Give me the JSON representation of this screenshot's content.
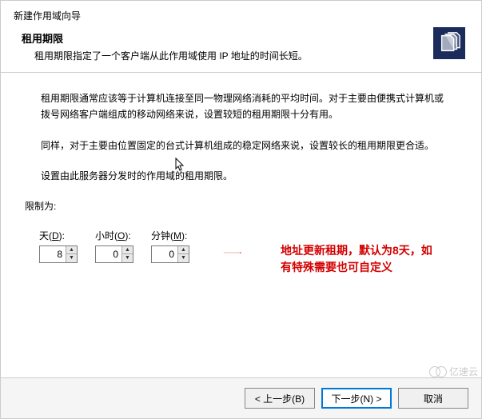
{
  "window_title": "新建作用域向导",
  "header": {
    "title": "租用期限",
    "description": "租用期限指定了一个客户端从此作用域使用 IP 地址的时间长短。"
  },
  "body": {
    "para1": "租用期限通常应该等于计算机连接至同一物理网络消耗的平均时间。对于主要由便携式计算机或拨号网络客户端组成的移动网络来说，设置较短的租用期限十分有用。",
    "para2": "同样，对于主要由位置固定的台式计算机组成的稳定网络来说，设置较长的租用期限更合适。",
    "para3": "设置由此服务器分发时的作用域的租用期限。",
    "limit_label": "限制为:"
  },
  "duration": {
    "days": {
      "label_prefix": "天(",
      "mnemonic": "D",
      "label_suffix": "):",
      "value": "8"
    },
    "hours": {
      "label_prefix": "小时(",
      "mnemonic": "O",
      "label_suffix": "):",
      "value": "0"
    },
    "minutes": {
      "label_prefix": "分钟(",
      "mnemonic": "M",
      "label_suffix": "):",
      "value": "0"
    }
  },
  "annotation": {
    "line1": "地址更新租期，默认为8天，如",
    "line2": "有特殊需要也可自定义"
  },
  "footer": {
    "back": "< 上一步(B)",
    "next": "下一步(N) >",
    "cancel": "取消"
  },
  "watermark": "亿速云"
}
